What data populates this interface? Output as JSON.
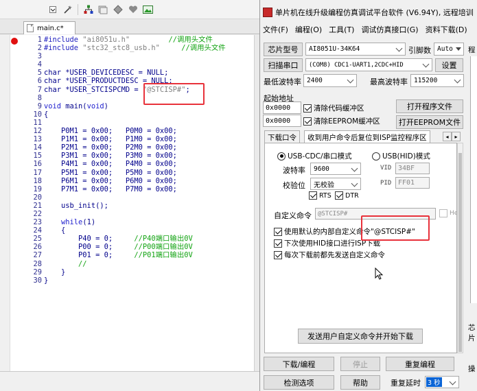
{
  "ide": {
    "tab_label": "main.c*",
    "code_lines": [
      {
        "n": "1",
        "parts": [
          {
            "c": "pp",
            "t": "#include "
          },
          {
            "c": "str",
            "t": "\"ai8051u.h\""
          },
          {
            "c": "txt",
            "t": "         "
          },
          {
            "c": "cmt",
            "t": "//调用头文件"
          }
        ]
      },
      {
        "n": "2",
        "parts": [
          {
            "c": "pp",
            "t": "#include "
          },
          {
            "c": "str",
            "t": "\"stc32_stc8_usb.h\""
          },
          {
            "c": "txt",
            "t": "     "
          },
          {
            "c": "cmt",
            "t": "//调用头文件"
          }
        ]
      },
      {
        "n": "3",
        "parts": []
      },
      {
        "n": "4",
        "parts": []
      },
      {
        "n": "5",
        "parts": [
          {
            "c": "txt",
            "t": "char *USER_DEVICEDESC = NULL;"
          }
        ]
      },
      {
        "n": "6",
        "parts": [
          {
            "c": "txt",
            "t": "char *USER_PRODUCTDESC = NULL;"
          }
        ]
      },
      {
        "n": "7",
        "parts": [
          {
            "c": "txt",
            "t": "char *USER_STCISPCMD = "
          },
          {
            "c": "str",
            "t": "\"@STCISP#\""
          },
          {
            "c": "txt",
            "t": ";"
          }
        ]
      },
      {
        "n": "8",
        "parts": []
      },
      {
        "n": "9",
        "parts": [
          {
            "c": "kw",
            "t": "void"
          },
          {
            "c": "txt",
            "t": " main("
          },
          {
            "c": "kw",
            "t": "void"
          },
          {
            "c": "txt",
            "t": ")"
          }
        ]
      },
      {
        "n": "10",
        "parts": [
          {
            "c": "txt",
            "t": "{"
          }
        ]
      },
      {
        "n": "11",
        "parts": []
      },
      {
        "n": "12",
        "parts": [
          {
            "c": "txt",
            "t": "    P0M1 = 0x00;   P0M0 = 0x00;"
          }
        ]
      },
      {
        "n": "13",
        "parts": [
          {
            "c": "txt",
            "t": "    P1M1 = 0x00;   P1M0 = 0x00;"
          }
        ]
      },
      {
        "n": "14",
        "parts": [
          {
            "c": "txt",
            "t": "    P2M1 = 0x00;   P2M0 = 0x00;"
          }
        ]
      },
      {
        "n": "15",
        "parts": [
          {
            "c": "txt",
            "t": "    P3M1 = 0x00;   P3M0 = 0x00;"
          }
        ]
      },
      {
        "n": "16",
        "parts": [
          {
            "c": "txt",
            "t": "    P4M1 = 0x00;   P4M0 = 0x00;"
          }
        ]
      },
      {
        "n": "17",
        "parts": [
          {
            "c": "txt",
            "t": "    P5M1 = 0x00;   P5M0 = 0x00;"
          }
        ]
      },
      {
        "n": "18",
        "parts": [
          {
            "c": "txt",
            "t": "    P6M1 = 0x00;   P6M0 = 0x00;"
          }
        ]
      },
      {
        "n": "19",
        "parts": [
          {
            "c": "txt",
            "t": "    P7M1 = 0x00;   P7M0 = 0x00;"
          }
        ]
      },
      {
        "n": "20",
        "parts": []
      },
      {
        "n": "21",
        "parts": [
          {
            "c": "txt",
            "t": "    usb_init();"
          }
        ]
      },
      {
        "n": "22",
        "parts": []
      },
      {
        "n": "23",
        "parts": [
          {
            "c": "txt",
            "t": "    "
          },
          {
            "c": "kw",
            "t": "while"
          },
          {
            "c": "txt",
            "t": "(1)"
          }
        ]
      },
      {
        "n": "24",
        "parts": [
          {
            "c": "txt",
            "t": "    {"
          }
        ]
      },
      {
        "n": "25",
        "parts": [
          {
            "c": "txt",
            "t": "        P40 = 0;     "
          },
          {
            "c": "cmt",
            "t": "//P40端口输出0V"
          }
        ]
      },
      {
        "n": "26",
        "parts": [
          {
            "c": "txt",
            "t": "        P00 = 0;     "
          },
          {
            "c": "cmt",
            "t": "//P00端口输出0V"
          }
        ]
      },
      {
        "n": "27",
        "parts": [
          {
            "c": "txt",
            "t": "        P01 = 0;     "
          },
          {
            "c": "cmt",
            "t": "//P01端口输出0V"
          }
        ]
      },
      {
        "n": "28",
        "parts": [
          {
            "c": "txt",
            "t": "        "
          },
          {
            "c": "cmt",
            "t": "//"
          }
        ]
      },
      {
        "n": "29",
        "parts": [
          {
            "c": "txt",
            "t": "    }"
          }
        ]
      },
      {
        "n": "30",
        "parts": [
          {
            "c": "txt",
            "t": "}"
          }
        ]
      }
    ]
  },
  "stc": {
    "title": "单片机在线升级编程仿真调试平台软件 (V6.94Y), 远程培训",
    "menu": [
      "文件(F)",
      "编程(O)",
      "工具(T)",
      "调试仿真接口(G)",
      "资料下载(D)"
    ],
    "chip_model_btn": "芯片型号",
    "chip_model_value": "AI8051U-34K64",
    "pin_count_label": "引脚数",
    "pin_count_value": "Auto",
    "scan_port_btn": "扫描串口",
    "port_value": "(COM8) CDC1-UART1,2CDC+HID",
    "settings_btn": "设置",
    "min_baud_label": "最低波特率",
    "min_baud_value": "2400",
    "max_baud_label": "最高波特率",
    "max_baud_value": "115200",
    "start_addr_label": "起始地址",
    "addr1_value": "0x0000",
    "clear_code_buf": "清除代码缓冲区",
    "open_program_btn": "打开程序文件",
    "addr2_value": "0x0000",
    "clear_eeprom_buf": "清除EEPROM缓冲区",
    "open_eeprom_btn": "打开EEPROM文件",
    "tabs": [
      "下载口令",
      "收到用户命令后复位到ISP监控程序区"
    ],
    "tab_nav_left": "◂",
    "tab_nav_right": "▸",
    "radio_usb_cdc": "USB-CDC/串口模式",
    "radio_usb_hid": "USB(HID)模式",
    "baud_label": "波特率",
    "baud_value": "9600",
    "parity_label": "校验位",
    "parity_value": "无校验",
    "vid_label": "VID",
    "vid_value": "34BF",
    "pid_label": "PID",
    "pid_value": "FF01",
    "rts_label": "RTS",
    "dtr_label": "DTR",
    "custom_cmd_label": "自定义命令",
    "custom_cmd_value": "@STCISP#",
    "hex_label": "Hex",
    "use_default_cmd": "使用默认的内部自定义命令\"@STCISP#\"",
    "next_download_hid": "下次使用HID接口进行ISP下载",
    "send_before_download": "每次下载前都先发送自定义命令",
    "send_cmd_btn": "发送用户自定义命令并开始下载",
    "download_btn": "下载/编程",
    "stop_btn": "停止",
    "reprogram_btn": "重复编程",
    "detect_btn": "检测选项",
    "help_btn": "帮助",
    "repeat_delay_label": "重复延时",
    "repeat_delay_value": "3 秒",
    "right_col": {
      "t1": "程",
      "t2": "芯片",
      "t3": "操"
    }
  }
}
